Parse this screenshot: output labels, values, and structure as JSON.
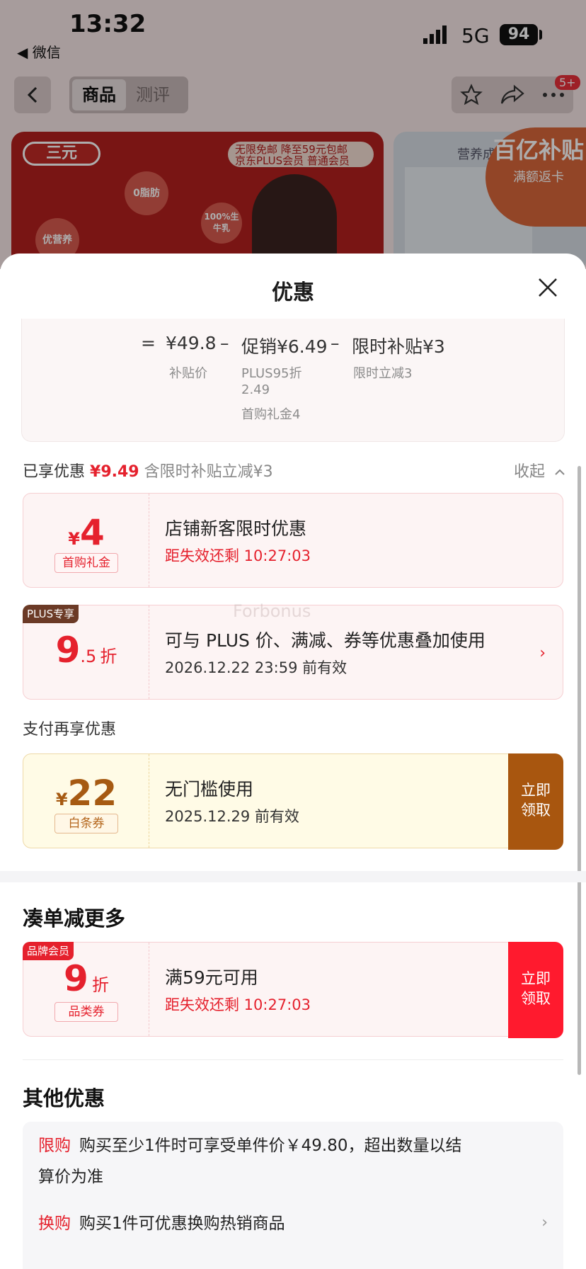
{
  "status": {
    "time": "13:32",
    "back_app": "◀ 微信",
    "network": "5G",
    "battery": "94"
  },
  "nav": {
    "tabs": [
      {
        "label": "商品"
      },
      {
        "label": "测评"
      }
    ],
    "badge": "5+"
  },
  "banner": {
    "brand": "三元",
    "tag_line1": "无限免邮 降至59元包邮",
    "tag_line2": "京东PLUS会员 普通会员",
    "bubbles": [
      "0脂肪",
      "100%生牛乳",
      "优营养"
    ],
    "nutrition_title": "营养成分",
    "promo_big": "百亿补贴",
    "promo_small": "满额返卡"
  },
  "sheet": {
    "title": "优惠",
    "calc": {
      "eq1": "=",
      "price": "¥49.8",
      "minus1": "–",
      "promo": "促销¥6.49",
      "minus2": "–",
      "subsidy": "限时补贴¥3",
      "price_label": "补贴价",
      "promo_sub1": "PLUS95折",
      "promo_sub2": "2.49",
      "promo_sub3": "首购礼金4",
      "subsidy_sub": "限时立减3"
    },
    "enjoyed": {
      "label": "已享优惠",
      "amount": "¥9.49",
      "note": "含限时补贴立减¥3",
      "collapse": "收起"
    },
    "coupons": [
      {
        "currency": "¥",
        "amount": "4",
        "pill": "首购礼金",
        "title": "店铺新客限时优惠",
        "sub": "距失效还剩 10:27:03"
      },
      {
        "tag": "PLUS专享",
        "amount": "9",
        "amount_dec": ".5",
        "unit": "折",
        "title": "可与 PLUS 价、满减、券等优惠叠加使用",
        "sub": "2026.12.22 23:59 前有效"
      }
    ],
    "pay_section_label": "支付再享优惠",
    "pay_coupon": {
      "currency": "¥",
      "amount": "22",
      "pill": "白条券",
      "title": "无门槛使用",
      "sub": "2025.12.29 前有效",
      "btn1": "立即",
      "btn2": "领取"
    },
    "more_title": "凑单减更多",
    "brand_coupon": {
      "tag": "品牌会员",
      "amount": "9",
      "unit": "折",
      "pill": "品类券",
      "title": "满59元可用",
      "sub": "距失效还剩 10:27:03",
      "btn1": "立即",
      "btn2": "领取"
    },
    "other_title": "其他优惠",
    "other": [
      {
        "key": "限购",
        "text1": "购买至少1件时可享受单件价￥49.80，超出数量以结",
        "text2": "算价为准"
      },
      {
        "key": "换购",
        "text1": "购买1件可优惠换购热销商品"
      }
    ],
    "watermark": "Forbonus"
  },
  "colors": {
    "accent_red": "#e5212d",
    "claim_brown": "#a8560f",
    "claim_red": "#ff1a2e"
  }
}
